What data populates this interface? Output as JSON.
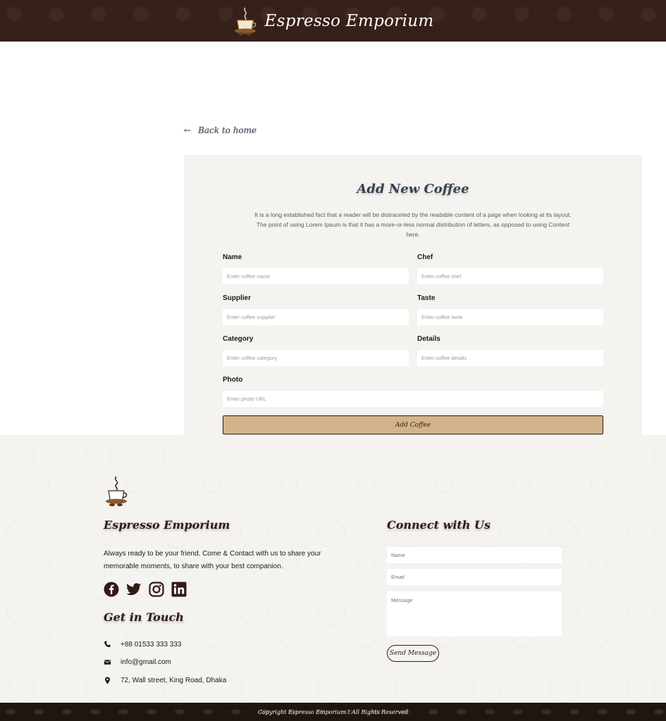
{
  "header": {
    "title": "Espresso Emporium",
    "logo_icon": "coffee-cup-logo-icon"
  },
  "back_link": {
    "label": "Back to home",
    "icon": "arrow-left-icon"
  },
  "form": {
    "title": "Add New Coffee",
    "description": "It is a long established fact that a reader will be distraceted by the readable content of a page when looking at its layout. The point of using Lorem Ipsum is that it has a more-or-less normal distribution of letters, as opposed to using Content here.",
    "fields": {
      "name": {
        "label": "Name",
        "placeholder": "Enter coffee name"
      },
      "chef": {
        "label": "Chef",
        "placeholder": "Enter coffee chef"
      },
      "supplier": {
        "label": "Supplier",
        "placeholder": "Enter coffee supplier"
      },
      "taste": {
        "label": "Taste",
        "placeholder": "Enter coffee taste"
      },
      "category": {
        "label": "Category",
        "placeholder": "Enter coffee category"
      },
      "details": {
        "label": "Details",
        "placeholder": "Enter coffee details"
      },
      "photo": {
        "label": "Photo",
        "placeholder": "Enter photo URL"
      }
    },
    "submit_label": "Add Coffee"
  },
  "footer": {
    "brand": "Espresso Emporium",
    "about": "Always ready to be your friend. Come & Contact with us to share your memorable moments, to share with your best companion.",
    "socials": [
      "facebook-icon",
      "twitter-icon",
      "instagram-icon",
      "linkedin-icon"
    ],
    "get_in_touch_title": "Get in Touch",
    "contact": {
      "phone": "+88 01533 333 333",
      "email": "info@gmail.com",
      "address": "72, Wall street, King Road, Dhaka"
    },
    "connect_title": "Connect with Us",
    "connect_form": {
      "name_placeholder": "Name",
      "email_placeholder": "Email",
      "message_placeholder": "Message",
      "send_label": "Send Message"
    },
    "copyright": "Copyright Espresso Emporium ! All Rights Reserved"
  },
  "colors": {
    "header_bg": "#372019",
    "card_bg": "#f4f3f0",
    "button_bg": "#d2b48c",
    "accent_dark": "#331a15"
  }
}
